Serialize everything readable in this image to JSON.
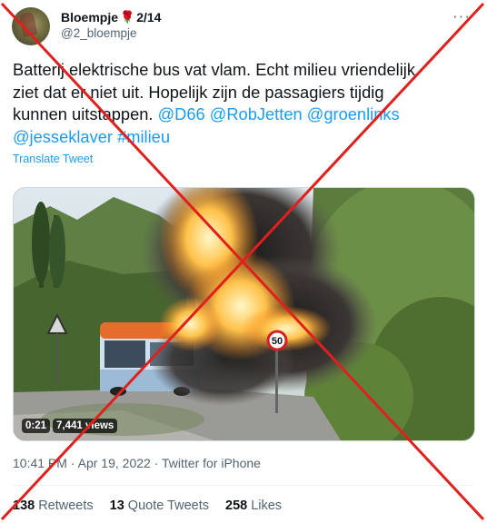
{
  "author": {
    "name": "Bloempje",
    "badge": "2/14",
    "handle": "@2_bloempje"
  },
  "tweet": {
    "line1": "Batterij elektrische bus vat vlam. Echt milieu vriendelijk",
    "line2": "ziet dat er niet uit. Hopelijk zijn de passagiers tijdig",
    "line3_text": "kunnen uitstappen. ",
    "mentions_line3": [
      "@D66",
      "@RobJetten",
      "@groenlinks"
    ],
    "mentions_line4": [
      "@jesseklaver",
      "#milieu"
    ],
    "translate_label": "Translate Tweet"
  },
  "media": {
    "duration": "0:21",
    "views": "7,441 views",
    "speed_sign": "50"
  },
  "meta": {
    "time": "10:41 PM",
    "date": "Apr 19, 2022",
    "source": "Twitter for iPhone",
    "separator": "·"
  },
  "stats": [
    {
      "count": "138",
      "label": "Retweets"
    },
    {
      "count": "13",
      "label": "Quote Tweets"
    },
    {
      "count": "258",
      "label": "Likes"
    }
  ],
  "overlay_color": "#e0201d"
}
